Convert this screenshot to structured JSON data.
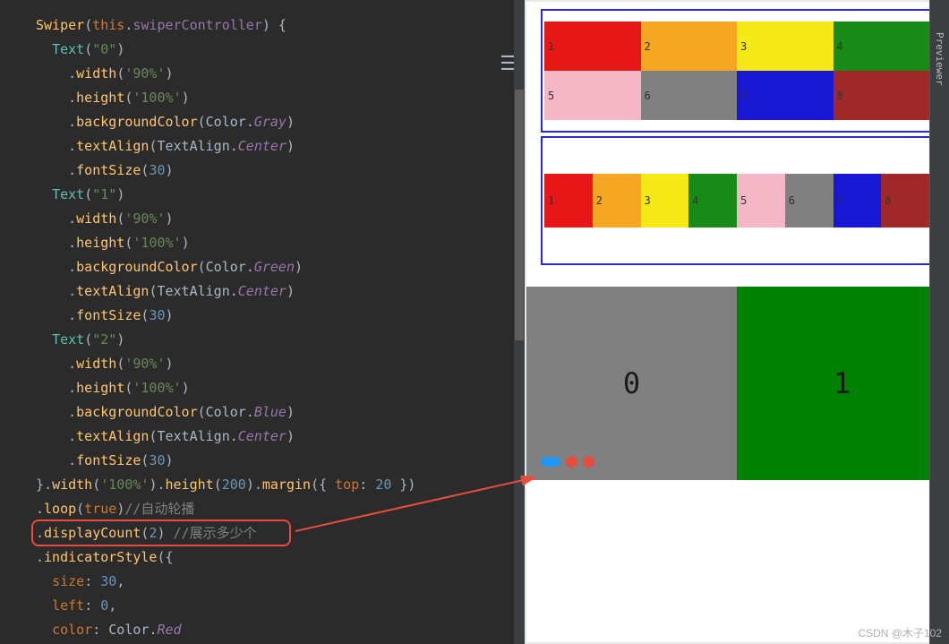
{
  "code": {
    "swiper_call": "Swiper",
    "this_kw": "this",
    "swiper_controller": "swiperController",
    "text0": "\"0\"",
    "text1": "\"1\"",
    "text2": "\"2\"",
    "width_method": "width",
    "height_method": "height",
    "bg_method": "backgroundColor",
    "textalign_method": "textAlign",
    "fontsize_method": "fontSize",
    "margin_method": "margin",
    "loop_method": "loop",
    "displaycount_method": "displayCount",
    "indicator_method": "indicatorStyle",
    "val_90pct": "'90%'",
    "val_100pct": "'100%'",
    "val_100pct_str": "'100%'",
    "color_class": "Color",
    "gray": "Gray",
    "green": "Green",
    "blue": "Blue",
    "red": "Red",
    "textalign_class": "TextAlign",
    "center": "Center",
    "val_30": "30",
    "val_200": "200",
    "val_20": "20",
    "val_2": "2",
    "val_0": "0",
    "true_kw": "true",
    "top_key": "top",
    "size_key": "size",
    "left_key": "left",
    "color_key": "color",
    "text_fn": "Text",
    "comment_loop": "//自动轮播",
    "comment_display": "//展示多少个"
  },
  "preview": {
    "grid1": [
      {
        "label": "1",
        "color": "#e81717"
      },
      {
        "label": "2",
        "color": "#f5a623"
      },
      {
        "label": "3",
        "color": "#f5ea17"
      },
      {
        "label": "4",
        "color": "#178a17"
      },
      {
        "label": "5",
        "color": "#f5b6c6"
      },
      {
        "label": "6",
        "color": "#808080"
      },
      {
        "label": "7",
        "color": "#1717d4"
      },
      {
        "label": "8",
        "color": "#a02828"
      }
    ],
    "grid2": [
      {
        "label": "1",
        "color": "#e81717"
      },
      {
        "label": "2",
        "color": "#f5a623"
      },
      {
        "label": "3",
        "color": "#f5ea17"
      },
      {
        "label": "4",
        "color": "#178a17"
      },
      {
        "label": "5",
        "color": "#f5b6c6"
      },
      {
        "label": "6",
        "color": "#808080"
      },
      {
        "label": "7",
        "color": "#1717d4"
      },
      {
        "label": "8",
        "color": "#a02828"
      }
    ],
    "swiper": {
      "page0": "0",
      "page1": "1"
    }
  },
  "side_tab": "Previewer",
  "watermark": "CSDN @木子102"
}
